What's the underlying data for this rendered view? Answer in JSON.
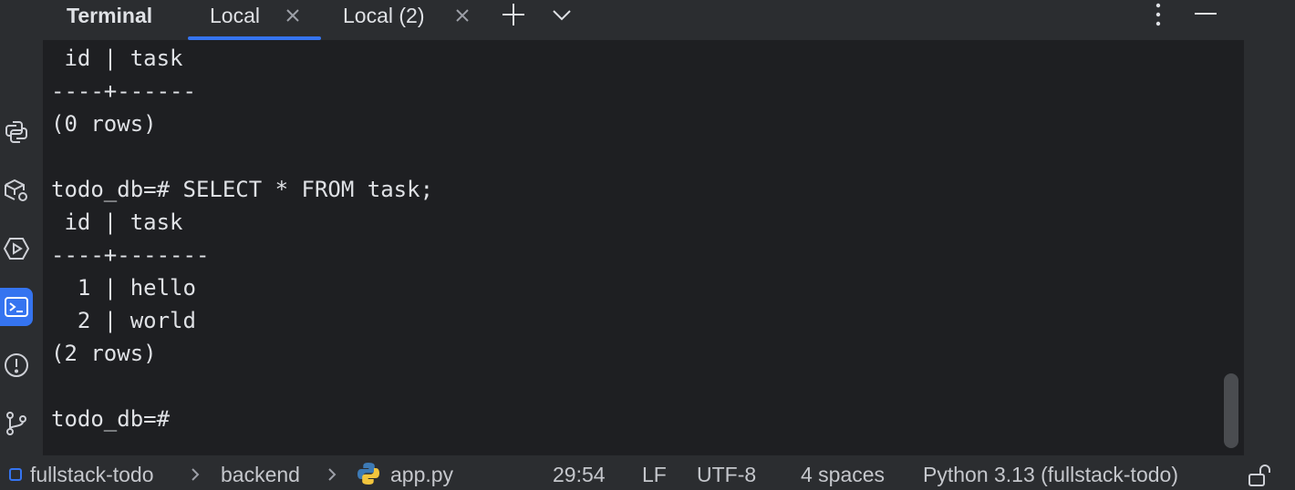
{
  "sidebar": {
    "items": [
      {
        "name": "python-console",
        "icon": "python-console-icon"
      },
      {
        "name": "python-packages",
        "icon": "packages-icon"
      },
      {
        "name": "services",
        "icon": "services-icon"
      },
      {
        "name": "terminal",
        "icon": "terminal-icon",
        "active": true
      },
      {
        "name": "problems",
        "icon": "problems-icon"
      },
      {
        "name": "version-control",
        "icon": "git-icon"
      }
    ]
  },
  "tabbar": {
    "title": "Terminal",
    "tabs": [
      {
        "label": "Local",
        "active": true
      },
      {
        "label": "Local (2)",
        "active": false
      }
    ],
    "actions": [
      "add-icon",
      "chevron-down-icon",
      "more-vertical-icon",
      "minimize-icon"
    ]
  },
  "terminal": {
    "lines": [
      " id | task",
      "----+------",
      "(0 rows)",
      "",
      "todo_db=# SELECT * FROM task;",
      " id | task",
      "----+-------",
      "  1 | hello",
      "  2 | world",
      "(2 rows)",
      "",
      "todo_db=#"
    ]
  },
  "statusbar": {
    "project": "fullstack-todo",
    "folder": "backend",
    "file": "app.py",
    "position": "29:54",
    "line_ending": "LF",
    "encoding": "UTF-8",
    "indent": "4 spaces",
    "interpreter": "Python 3.13 (fullstack-todo)"
  },
  "colors": {
    "accent": "#3574f0",
    "panel_bg": "#1e1f22",
    "chrome_bg": "#2b2d30",
    "text": "#dfe1e5"
  }
}
